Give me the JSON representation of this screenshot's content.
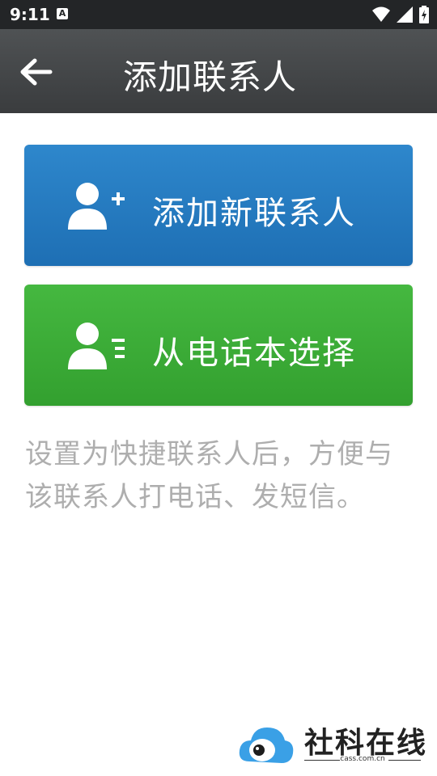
{
  "status_bar": {
    "time": "9:11",
    "notification_icon": "A"
  },
  "app_bar": {
    "title": "添加联系人",
    "back_icon": "back-arrow-icon"
  },
  "buttons": {
    "add_new": {
      "label": "添加新联系人",
      "icon": "person-add-icon",
      "color": "#2a7fc4"
    },
    "choose_from_phonebook": {
      "label": "从电话本选择",
      "icon": "person-list-icon",
      "color": "#3eac37"
    }
  },
  "hint_text": "设置为快捷联系人后，方便与该联系人打电话、发短信。",
  "watermark": {
    "name": "社科在线",
    "url": "cass.com.cn"
  }
}
